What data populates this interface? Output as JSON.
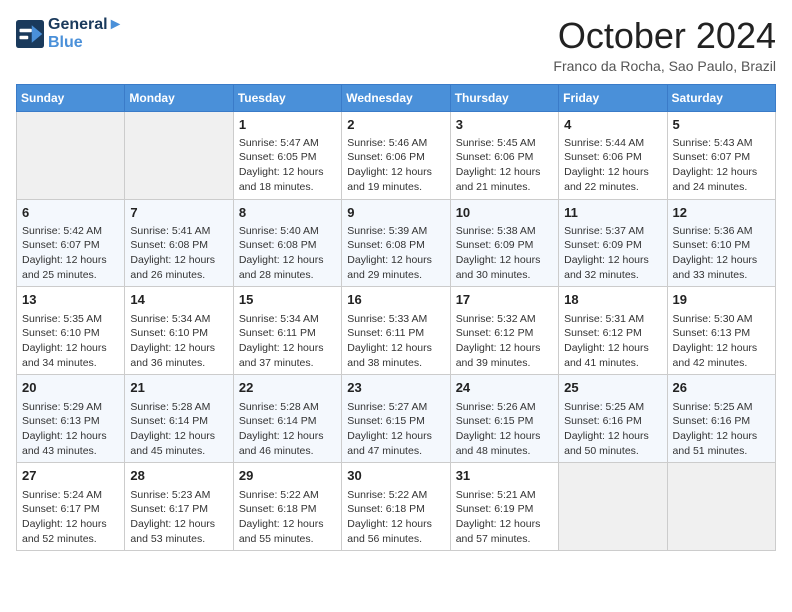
{
  "header": {
    "logo_line1": "General",
    "logo_line2": "Blue",
    "month": "October 2024",
    "location": "Franco da Rocha, Sao Paulo, Brazil"
  },
  "days_of_week": [
    "Sunday",
    "Monday",
    "Tuesday",
    "Wednesday",
    "Thursday",
    "Friday",
    "Saturday"
  ],
  "weeks": [
    [
      {
        "day": "",
        "sunrise": "",
        "sunset": "",
        "daylight": ""
      },
      {
        "day": "",
        "sunrise": "",
        "sunset": "",
        "daylight": ""
      },
      {
        "day": "1",
        "sunrise": "Sunrise: 5:47 AM",
        "sunset": "Sunset: 6:05 PM",
        "daylight": "Daylight: 12 hours and 18 minutes."
      },
      {
        "day": "2",
        "sunrise": "Sunrise: 5:46 AM",
        "sunset": "Sunset: 6:06 PM",
        "daylight": "Daylight: 12 hours and 19 minutes."
      },
      {
        "day": "3",
        "sunrise": "Sunrise: 5:45 AM",
        "sunset": "Sunset: 6:06 PM",
        "daylight": "Daylight: 12 hours and 21 minutes."
      },
      {
        "day": "4",
        "sunrise": "Sunrise: 5:44 AM",
        "sunset": "Sunset: 6:06 PM",
        "daylight": "Daylight: 12 hours and 22 minutes."
      },
      {
        "day": "5",
        "sunrise": "Sunrise: 5:43 AM",
        "sunset": "Sunset: 6:07 PM",
        "daylight": "Daylight: 12 hours and 24 minutes."
      }
    ],
    [
      {
        "day": "6",
        "sunrise": "Sunrise: 5:42 AM",
        "sunset": "Sunset: 6:07 PM",
        "daylight": "Daylight: 12 hours and 25 minutes."
      },
      {
        "day": "7",
        "sunrise": "Sunrise: 5:41 AM",
        "sunset": "Sunset: 6:08 PM",
        "daylight": "Daylight: 12 hours and 26 minutes."
      },
      {
        "day": "8",
        "sunrise": "Sunrise: 5:40 AM",
        "sunset": "Sunset: 6:08 PM",
        "daylight": "Daylight: 12 hours and 28 minutes."
      },
      {
        "day": "9",
        "sunrise": "Sunrise: 5:39 AM",
        "sunset": "Sunset: 6:08 PM",
        "daylight": "Daylight: 12 hours and 29 minutes."
      },
      {
        "day": "10",
        "sunrise": "Sunrise: 5:38 AM",
        "sunset": "Sunset: 6:09 PM",
        "daylight": "Daylight: 12 hours and 30 minutes."
      },
      {
        "day": "11",
        "sunrise": "Sunrise: 5:37 AM",
        "sunset": "Sunset: 6:09 PM",
        "daylight": "Daylight: 12 hours and 32 minutes."
      },
      {
        "day": "12",
        "sunrise": "Sunrise: 5:36 AM",
        "sunset": "Sunset: 6:10 PM",
        "daylight": "Daylight: 12 hours and 33 minutes."
      }
    ],
    [
      {
        "day": "13",
        "sunrise": "Sunrise: 5:35 AM",
        "sunset": "Sunset: 6:10 PM",
        "daylight": "Daylight: 12 hours and 34 minutes."
      },
      {
        "day": "14",
        "sunrise": "Sunrise: 5:34 AM",
        "sunset": "Sunset: 6:10 PM",
        "daylight": "Daylight: 12 hours and 36 minutes."
      },
      {
        "day": "15",
        "sunrise": "Sunrise: 5:34 AM",
        "sunset": "Sunset: 6:11 PM",
        "daylight": "Daylight: 12 hours and 37 minutes."
      },
      {
        "day": "16",
        "sunrise": "Sunrise: 5:33 AM",
        "sunset": "Sunset: 6:11 PM",
        "daylight": "Daylight: 12 hours and 38 minutes."
      },
      {
        "day": "17",
        "sunrise": "Sunrise: 5:32 AM",
        "sunset": "Sunset: 6:12 PM",
        "daylight": "Daylight: 12 hours and 39 minutes."
      },
      {
        "day": "18",
        "sunrise": "Sunrise: 5:31 AM",
        "sunset": "Sunset: 6:12 PM",
        "daylight": "Daylight: 12 hours and 41 minutes."
      },
      {
        "day": "19",
        "sunrise": "Sunrise: 5:30 AM",
        "sunset": "Sunset: 6:13 PM",
        "daylight": "Daylight: 12 hours and 42 minutes."
      }
    ],
    [
      {
        "day": "20",
        "sunrise": "Sunrise: 5:29 AM",
        "sunset": "Sunset: 6:13 PM",
        "daylight": "Daylight: 12 hours and 43 minutes."
      },
      {
        "day": "21",
        "sunrise": "Sunrise: 5:28 AM",
        "sunset": "Sunset: 6:14 PM",
        "daylight": "Daylight: 12 hours and 45 minutes."
      },
      {
        "day": "22",
        "sunrise": "Sunrise: 5:28 AM",
        "sunset": "Sunset: 6:14 PM",
        "daylight": "Daylight: 12 hours and 46 minutes."
      },
      {
        "day": "23",
        "sunrise": "Sunrise: 5:27 AM",
        "sunset": "Sunset: 6:15 PM",
        "daylight": "Daylight: 12 hours and 47 minutes."
      },
      {
        "day": "24",
        "sunrise": "Sunrise: 5:26 AM",
        "sunset": "Sunset: 6:15 PM",
        "daylight": "Daylight: 12 hours and 48 minutes."
      },
      {
        "day": "25",
        "sunrise": "Sunrise: 5:25 AM",
        "sunset": "Sunset: 6:16 PM",
        "daylight": "Daylight: 12 hours and 50 minutes."
      },
      {
        "day": "26",
        "sunrise": "Sunrise: 5:25 AM",
        "sunset": "Sunset: 6:16 PM",
        "daylight": "Daylight: 12 hours and 51 minutes."
      }
    ],
    [
      {
        "day": "27",
        "sunrise": "Sunrise: 5:24 AM",
        "sunset": "Sunset: 6:17 PM",
        "daylight": "Daylight: 12 hours and 52 minutes."
      },
      {
        "day": "28",
        "sunrise": "Sunrise: 5:23 AM",
        "sunset": "Sunset: 6:17 PM",
        "daylight": "Daylight: 12 hours and 53 minutes."
      },
      {
        "day": "29",
        "sunrise": "Sunrise: 5:22 AM",
        "sunset": "Sunset: 6:18 PM",
        "daylight": "Daylight: 12 hours and 55 minutes."
      },
      {
        "day": "30",
        "sunrise": "Sunrise: 5:22 AM",
        "sunset": "Sunset: 6:18 PM",
        "daylight": "Daylight: 12 hours and 56 minutes."
      },
      {
        "day": "31",
        "sunrise": "Sunrise: 5:21 AM",
        "sunset": "Sunset: 6:19 PM",
        "daylight": "Daylight: 12 hours and 57 minutes."
      },
      {
        "day": "",
        "sunrise": "",
        "sunset": "",
        "daylight": ""
      },
      {
        "day": "",
        "sunrise": "",
        "sunset": "",
        "daylight": ""
      }
    ]
  ]
}
